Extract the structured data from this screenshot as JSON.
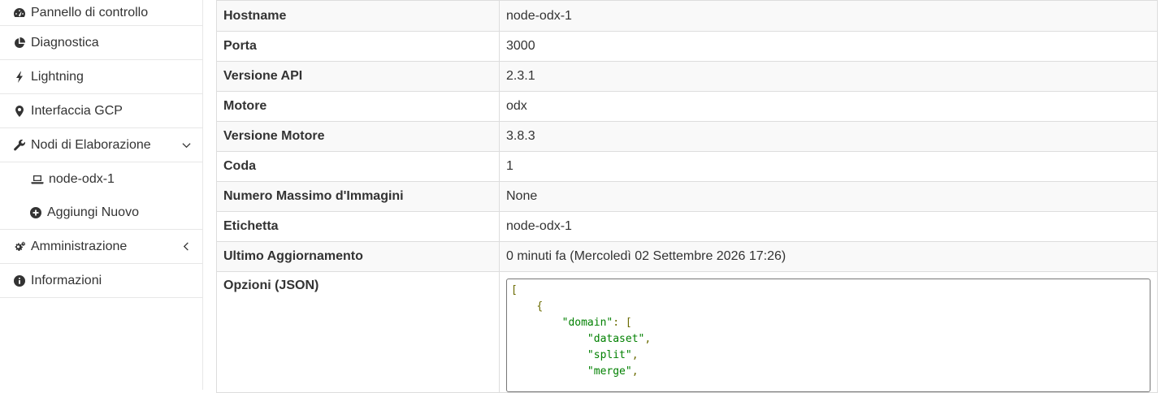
{
  "sidebar": {
    "items": [
      {
        "label": "Pannello di controllo",
        "icon": "dashboard-icon"
      },
      {
        "label": "Diagnostica",
        "icon": "pie-chart-icon"
      },
      {
        "label": "Lightning",
        "icon": "bolt-icon"
      },
      {
        "label": "Interfaccia GCP",
        "icon": "map-marker-icon"
      },
      {
        "label": "Nodi di Elaborazione",
        "icon": "wrench-icon",
        "expanded": true,
        "children": [
          {
            "label": "node-odx-1",
            "icon": "laptop-icon"
          },
          {
            "label": "Aggiungi Nuovo",
            "icon": "plus-circle-icon"
          }
        ]
      },
      {
        "label": "Amministrazione",
        "icon": "gears-icon"
      },
      {
        "label": "Informazioni",
        "icon": "info-circle-icon"
      }
    ]
  },
  "node_info": {
    "rows": [
      {
        "key": "Hostname",
        "value": "node-odx-1"
      },
      {
        "key": "Porta",
        "value": "3000"
      },
      {
        "key": "Versione API",
        "value": "2.3.1"
      },
      {
        "key": "Motore",
        "value": "odx"
      },
      {
        "key": "Versione Motore",
        "value": "3.8.3"
      },
      {
        "key": "Coda",
        "value": "1"
      },
      {
        "key": "Numero Massimo d'Immagini",
        "value": "None"
      },
      {
        "key": "Etichetta",
        "value": "node-odx-1"
      },
      {
        "key": "Ultimo Aggiornamento",
        "value": "0 minuti fa (Mercoledì 02 Settembre 2026 17:26)"
      }
    ],
    "options_label": "Opzioni (JSON)",
    "options_json_lines": [
      "[",
      "{",
      "\"domain\": [",
      "\"dataset\",",
      "\"split\",",
      "\"merge\","
    ]
  },
  "colors": {
    "json_string": "#008000",
    "json_punctuation": "#6b6b00",
    "border": "#dddddd"
  }
}
